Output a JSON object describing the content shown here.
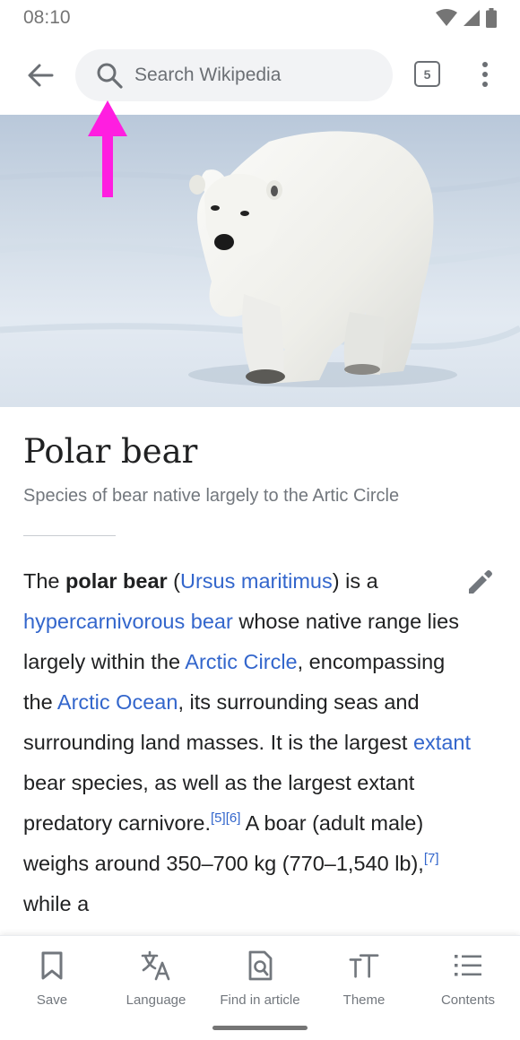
{
  "status_bar": {
    "time": "08:10"
  },
  "toolbar": {
    "search_placeholder": "Search Wikipedia",
    "tab_count": "5"
  },
  "article": {
    "title": "Polar bear",
    "description": "Species of bear native largely to the Artic Circle",
    "para": {
      "t1": "The ",
      "b1": "polar bear",
      "t2": " (",
      "l1": "Ursus maritimus",
      "t3": ") is a ",
      "l2": "hypercarnivorous bear",
      "t4": " whose native range lies largely within the ",
      "l3": "Arctic Circle",
      "t5": ", encompassing the ",
      "l4": "Arctic Ocean",
      "t6": ", its surrounding seas and surrounding land masses. It is the largest ",
      "l5": "extant",
      "t7": " bear species, as well as the largest extant predatory carnivore.",
      "r1": "[5]",
      "r2": "[6]",
      "t8": " A boar (adult male) weighs around 350–700 kg (770–1,540 lb),",
      "r3": "[7]",
      "t9": " while a"
    }
  },
  "bottom_bar": {
    "save": "Save",
    "language": "Language",
    "find": "Find in article",
    "theme": "Theme",
    "contents": "Contents"
  },
  "colors": {
    "link": "#3366cc",
    "annotation_arrow": "#ff1ee0"
  },
  "icons": [
    "signal-wifi-icon",
    "signal-cellular-icon",
    "battery-icon",
    "back-arrow-icon",
    "search-icon",
    "tabs-icon",
    "overflow-menu-icon",
    "edit-pencil-icon",
    "bookmark-icon",
    "translate-icon",
    "find-in-page-icon",
    "text-size-icon",
    "list-icon"
  ]
}
